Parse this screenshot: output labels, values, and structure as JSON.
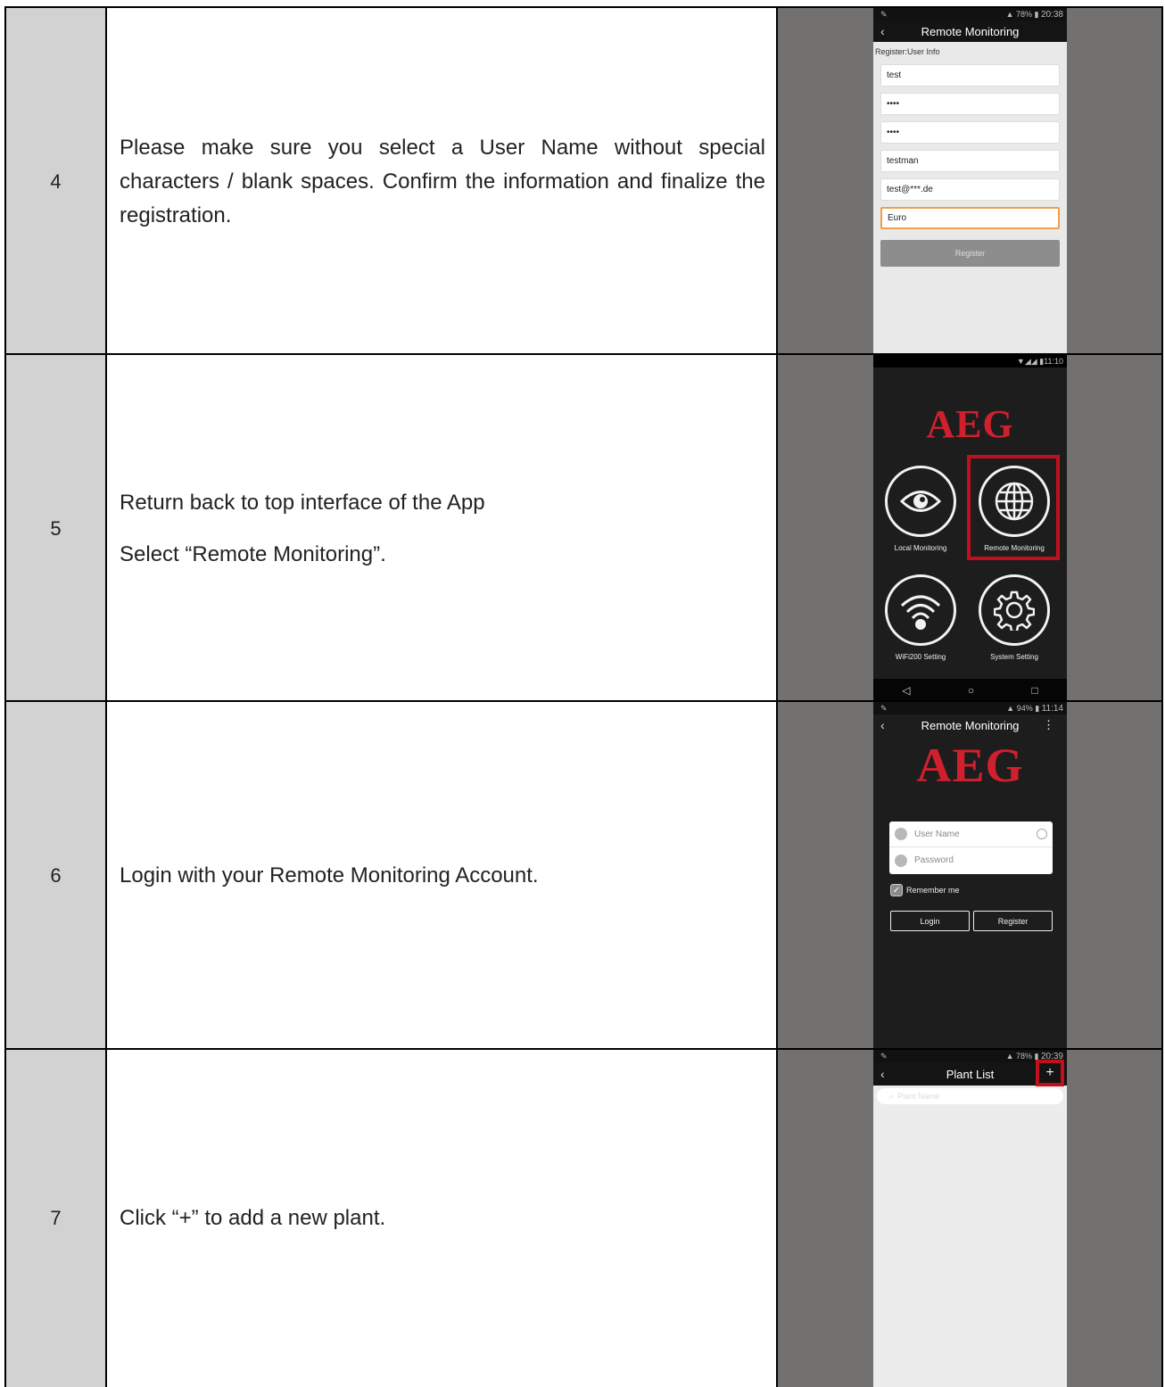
{
  "rows": [
    {
      "num": "4",
      "paragraphs": [
        "Please make sure you select a User Name without special characters / blank spaces. Confirm the information and finalize the registration."
      ],
      "phone": {
        "status_time": "20:38",
        "status_battery": "78%",
        "title": "Remote Monitoring",
        "section_label": "Register:User Info",
        "fields": [
          "test",
          "••••",
          "••••",
          "testman",
          "test@***.de",
          "Euro"
        ],
        "button": "Register"
      }
    },
    {
      "num": "5",
      "paragraphs": [
        "Return back to top interface of the App",
        "Select “Remote Monitoring”."
      ],
      "phone": {
        "status_time": "11:10",
        "logo": "AEG",
        "tiles": [
          "Local Monitoring",
          "Remote Monitoring",
          "WiFi200 Setting",
          "System Setting"
        ],
        "nav": [
          "◁",
          "○",
          "□"
        ]
      }
    },
    {
      "num": "6",
      "paragraphs": [
        "Login with your Remote Monitoring Account."
      ],
      "phone": {
        "status_time": "11:14",
        "status_battery": "94%",
        "title": "Remote Monitoring",
        "logo": "AEG",
        "username_placeholder": "User Name",
        "password_placeholder": "Password",
        "remember": "Remember me",
        "login": "Login",
        "register": "Register"
      }
    },
    {
      "num": "7",
      "paragraphs": [
        "Click “+” to add a new plant."
      ],
      "phone": {
        "status_time": "20:39",
        "status_battery": "78%",
        "title": "Plant List",
        "add": "+",
        "search_placeholder": "Plant Name"
      }
    }
  ],
  "colors": {
    "highlight": "#c0101e",
    "logo": "#d0202d",
    "number_column": "#d2d2d2",
    "screenshot_column": "#737070"
  }
}
